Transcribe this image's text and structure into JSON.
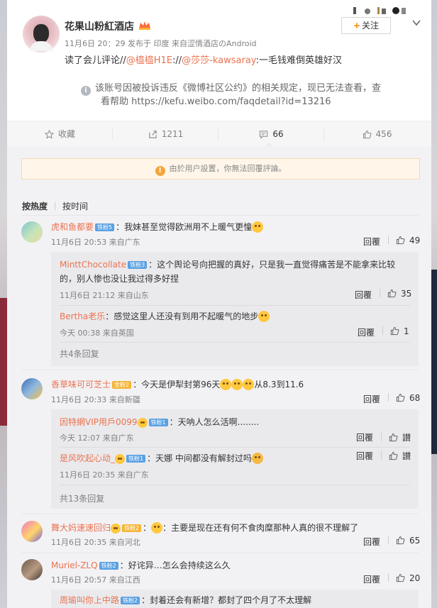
{
  "post": {
    "username": "花果山粉紅酒店",
    "meta": "11月6日 20：29 发布于 印度 来自涩情酒店のAndroid",
    "content_prefix": "读了会儿评论//",
    "mention1": "@橀橀H1E",
    "content_mid": "://",
    "mention2": "@莎莎-kawsaray",
    "content_suffix": ":一毛钱难倒英雄好汉",
    "follow_label": "关注",
    "notice_line1": "该账号因被投诉违反《微博社区公约》的相关规定，现已无法查看，查",
    "notice_line2": "看帮助 https://kefu.weibo.com/faqdetail?id=13216"
  },
  "actions": {
    "collect_label": "收藏",
    "repost_count": "1211",
    "comment_count": "66",
    "like_count": "456"
  },
  "comments_area": {
    "banner_text": "由於用户設置，你無法回覆評論。",
    "sort_hot": "按热度",
    "sort_time": "按时间",
    "reply_label": "回覆",
    "list": [
      {
        "name": "虎和鱼都要",
        "level": "铁粉5",
        "text": "：我妹甚至觉得欧洲用不上暖气更憧",
        "meta": "11月6日 20:53 来自广东",
        "likes": "49",
        "subs": [
          {
            "name": "MinttChocollate",
            "level": "铁粉3",
            "text1": "：这个舆论号向把握的真好，只是我一直觉得痛苦是不能拿来比较",
            "text2": "的，别人惨也没让我过得多好捏",
            "meta": "11月6日 21:12 来自山东",
            "likes": "35"
          },
          {
            "name": "Bertha老乐",
            "level": "",
            "text1": "：感觉这里人还没有到用不起暖气的地步",
            "text2": "",
            "meta": "今天 00:38 来自英国",
            "likes": "1"
          }
        ],
        "more": "共4条回复"
      },
      {
        "name": "香草味可可芝士",
        "level": "金粉2",
        "text": "：今天是伊犁封第96天",
        "text_suffix": "从8.3到11.6",
        "meta": "11月6日 20:33 来自新疆",
        "likes": "68",
        "subs": [
          {
            "name": "因特網VIP用戶0099",
            "level": "铁粉1",
            "text1": "：天呐人怎么活啊........",
            "text2": "",
            "meta": "今天 12:07 来自广东",
            "likes": "讃"
          },
          {
            "name": "是风吹起心动_",
            "level": "铁粉1",
            "text1": "：天娜 中间都没有解封过吗",
            "text2": "",
            "meta": "11月6日 20:35 来自广东",
            "likes": "讃"
          }
        ],
        "more": "共13条回复"
      },
      {
        "name": "舞大妈速速回归",
        "level": "铁粉2",
        "text": "：主要是现在还有何不食肉糜那种人真的很不理解了",
        "meta": "11月6日 20:35 来自河北",
        "likes": "65"
      },
      {
        "name": "Muriel-ZLQ",
        "level": "铁粉2",
        "text": "：好诧异…怎么会持续这么久",
        "meta": "11月6日 20:57 来自江西",
        "likes": "20",
        "subs": [
          {
            "name": "周瑜叫你上中路",
            "level": "铁粉2",
            "text1": "：封着还会有新增？都封了四个月了不太理解",
            "text2": "",
            "meta": "",
            "likes": ""
          }
        ]
      }
    ]
  },
  "colors": {
    "accent": "#eb7350",
    "link_orange": "#ff8200",
    "sub_bg": "#eaeaed"
  }
}
